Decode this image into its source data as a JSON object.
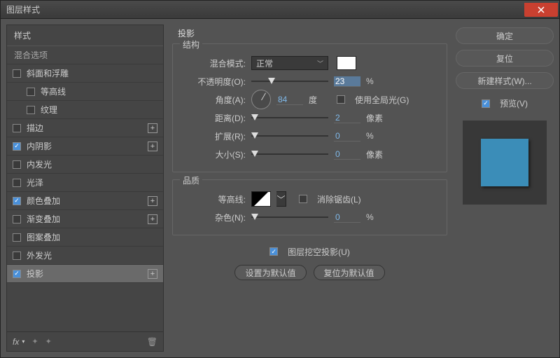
{
  "window": {
    "title": "图层样式"
  },
  "left": {
    "styles_header": "样式",
    "blend_header": "混合选项",
    "items": [
      {
        "label": "斜面和浮雕",
        "checked": false,
        "plus": false,
        "indent": false
      },
      {
        "label": "等高线",
        "checked": false,
        "plus": false,
        "indent": true
      },
      {
        "label": "纹理",
        "checked": false,
        "plus": false,
        "indent": true
      },
      {
        "label": "描边",
        "checked": false,
        "plus": true,
        "indent": false
      },
      {
        "label": "内阴影",
        "checked": true,
        "plus": true,
        "indent": false
      },
      {
        "label": "内发光",
        "checked": false,
        "plus": false,
        "indent": false
      },
      {
        "label": "光泽",
        "checked": false,
        "plus": false,
        "indent": false
      },
      {
        "label": "颜色叠加",
        "checked": true,
        "plus": true,
        "indent": false
      },
      {
        "label": "渐变叠加",
        "checked": false,
        "plus": true,
        "indent": false
      },
      {
        "label": "图案叠加",
        "checked": false,
        "plus": false,
        "indent": false
      },
      {
        "label": "外发光",
        "checked": false,
        "plus": false,
        "indent": false
      },
      {
        "label": "投影",
        "checked": true,
        "plus": true,
        "indent": false,
        "selected": true
      }
    ],
    "fx": "fx"
  },
  "center": {
    "title": "投影",
    "group1": "结构",
    "blend_mode_label": "混合模式:",
    "blend_mode_value": "正常",
    "opacity_label": "不透明度(O):",
    "opacity_value": "23",
    "opacity_unit": "%",
    "angle_label": "角度(A):",
    "angle_value": "84",
    "angle_unit": "度",
    "global_light": "使用全局光(G)",
    "distance_label": "距离(D):",
    "distance_value": "2",
    "distance_unit": "像素",
    "spread_label": "扩展(R):",
    "spread_value": "0",
    "spread_unit": "%",
    "size_label": "大小(S):",
    "size_value": "0",
    "size_unit": "像素",
    "group2": "品质",
    "contour_label": "等高线:",
    "antialias": "消除锯齿(L)",
    "noise_label": "杂色(N):",
    "noise_value": "0",
    "noise_unit": "%",
    "knockout": "图层挖空投影(U)",
    "btn_default": "设置为默认值",
    "btn_reset": "复位为默认值"
  },
  "right": {
    "ok": "确定",
    "cancel": "复位",
    "new_style": "新建样式(W)...",
    "preview": "预览(V)"
  }
}
